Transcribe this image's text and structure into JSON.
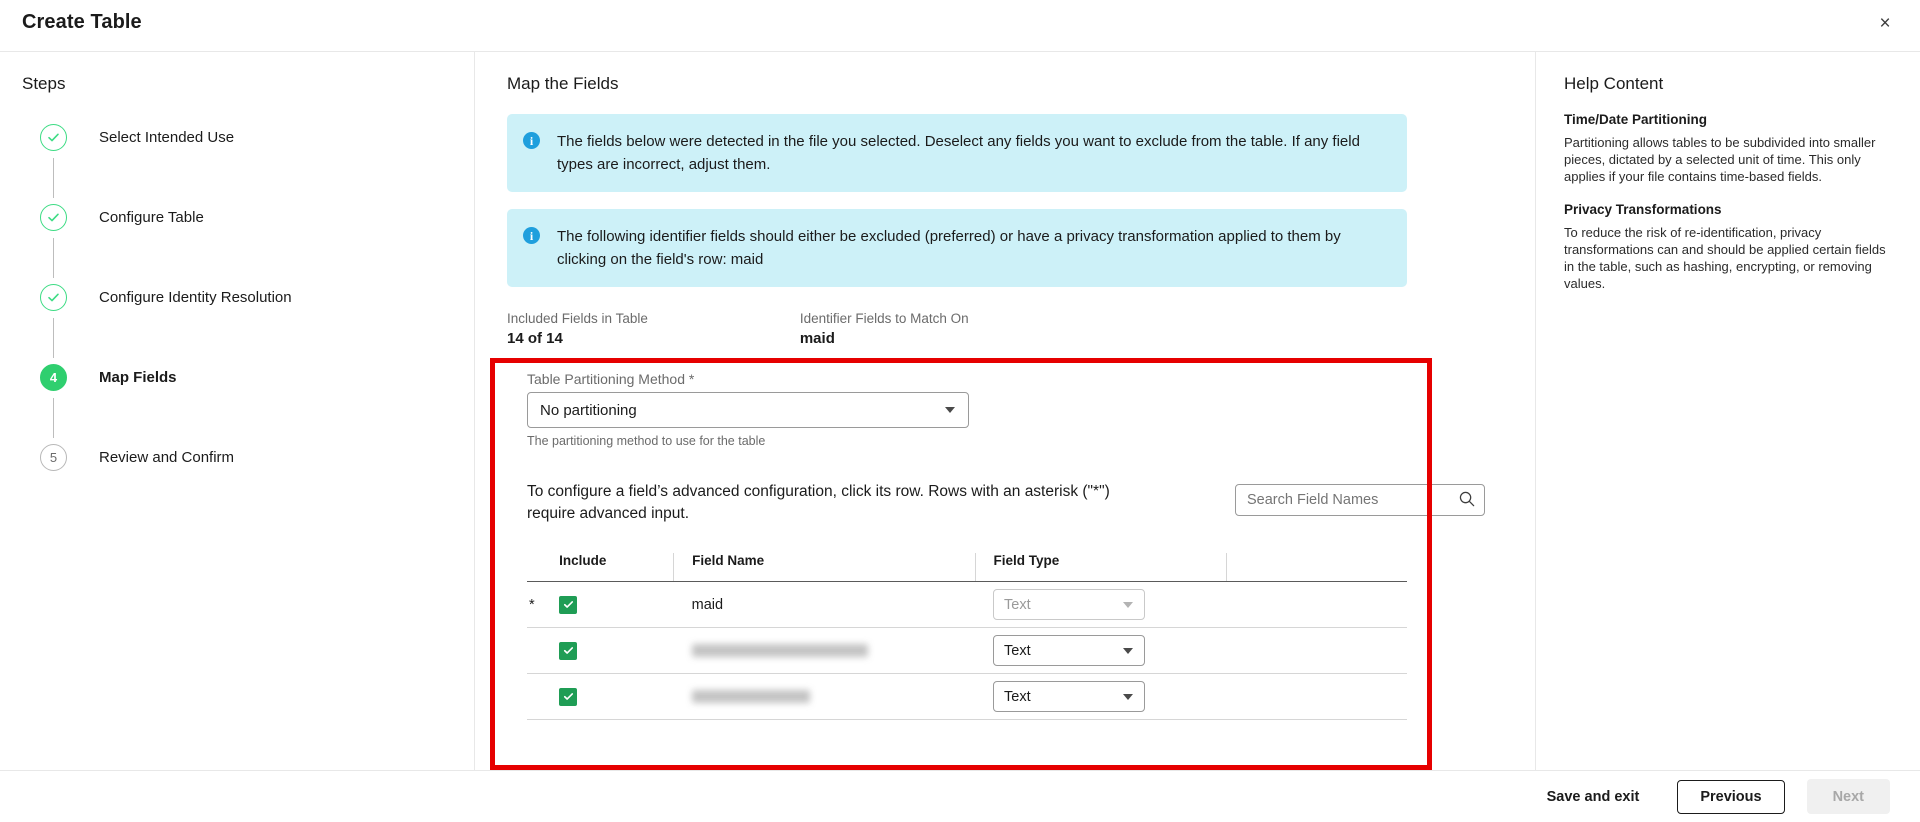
{
  "window": {
    "title": "Create Table",
    "close_label": "×"
  },
  "steps_panel": {
    "heading": "Steps",
    "items": [
      {
        "marker": "✓",
        "label": "Select Intended Use",
        "state": "done"
      },
      {
        "marker": "✓",
        "label": "Configure Table",
        "state": "done"
      },
      {
        "marker": "✓",
        "label": "Configure Identity Resolution",
        "state": "done"
      },
      {
        "marker": "4",
        "label": "Map Fields",
        "state": "current"
      },
      {
        "marker": "5",
        "label": "Review and Confirm",
        "state": "pending"
      }
    ]
  },
  "main": {
    "title": "Map the Fields",
    "banners": [
      {
        "icon": "info-icon",
        "text": "The fields below were detected in the file you selected. Deselect any fields you want to exclude from the table. If any field types are incorrect, adjust them."
      },
      {
        "icon": "info-icon",
        "text": "The following identifier fields should either be excluded (preferred) or have a privacy transformation applied to them by clicking on the field's row: maid"
      }
    ],
    "summary": [
      {
        "label": "Included Fields in Table",
        "value": "14 of 14"
      },
      {
        "label": "Identifier Fields to Match On",
        "value": "maid"
      }
    ],
    "partitioning": {
      "label": "Table Partitioning Method *",
      "value": "No partitioning",
      "hint": "The partitioning method to use for the table"
    },
    "table_intro": "To configure a field’s advanced configuration, click its row. Rows with an asterisk (\"*\") require advanced input.",
    "search": {
      "placeholder": "Search Field Names",
      "value": "",
      "icon": "search-icon"
    },
    "fields_table": {
      "columns": [
        "",
        "Include",
        "Field Name",
        "Field Type",
        ""
      ],
      "rows": [
        {
          "asterisk": "*",
          "included": true,
          "name": "maid",
          "name_redacted": false,
          "redacted_width": 0,
          "type": "Text",
          "type_disabled": true
        },
        {
          "asterisk": "",
          "included": true,
          "name": "",
          "name_redacted": true,
          "redacted_width": 176,
          "type": "Text",
          "type_disabled": false
        },
        {
          "asterisk": "",
          "included": true,
          "name": "",
          "name_redacted": true,
          "redacted_width": 118,
          "type": "Text",
          "type_disabled": false
        }
      ]
    }
  },
  "help": {
    "title": "Help Content",
    "sections": [
      {
        "heading": "Time/Date Partitioning",
        "body": "Partitioning allows tables to be subdivided into smaller pieces, dictated by a selected unit of time. This only applies if your file contains time-based fields."
      },
      {
        "heading": "Privacy Transformations",
        "body": "To reduce the risk of re-identification, privacy transformations can and should be applied certain fields in the table, such as hashing, encrypting, or removing values."
      }
    ]
  },
  "footer": {
    "save_and_exit": "Save and exit",
    "previous": "Previous",
    "next": "Next"
  },
  "annotation": {
    "highlight_color": "#e60000"
  },
  "colors": {
    "accent_green": "#2fcf6f",
    "info_bg": "#cdf1f8",
    "info_icon": "#1f9fdd",
    "checkbox_green": "#1f9d55"
  }
}
